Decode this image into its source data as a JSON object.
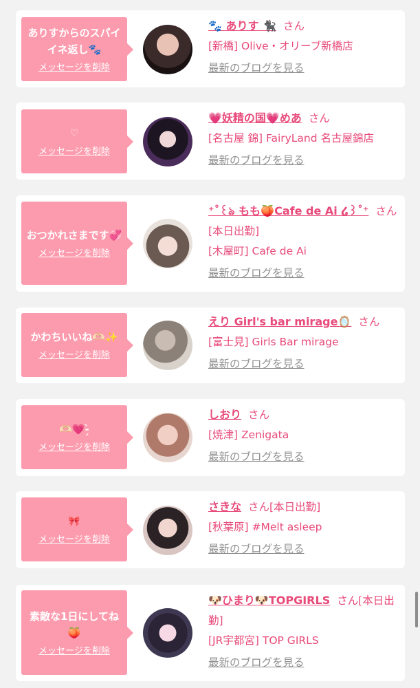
{
  "ui": {
    "delete_label": "メッセージを削除",
    "blog_label": "最新のブログを見る",
    "honorific": "さん"
  },
  "cards": [
    {
      "message": "ありすからのスパイイネ返し🐾",
      "name": "🐾 ありす 🐈‍⬛",
      "name_suffix": "",
      "shops": [
        "[新橋] Olive・オリーブ新橋店"
      ],
      "avatar_icon": "profile-photo"
    },
    {
      "message": "♡",
      "name": "💗妖精の国💗めあ",
      "name_suffix": "",
      "shops": [
        "[名古屋 錦] FairyLand 名古屋錦店"
      ],
      "avatar_icon": "profile-photo"
    },
    {
      "message": "おつかれさまです💞",
      "name": "⁺˚꒰ঌ もも🍑Cafe de Ai ໒꒱˚⁺",
      "name_suffix": "",
      "shops": [
        "[本日出勤]",
        "[木屋町] Cafe de Ai"
      ],
      "avatar_icon": "profile-photo"
    },
    {
      "message": "かわちいいね🫶🏻✨",
      "name": "えり Girl's bar mirage🪞",
      "name_suffix": "",
      "shops": [
        "[富士見] Girls Bar mirage"
      ],
      "avatar_icon": "profile-photo"
    },
    {
      "message": "🫶🏻💗-̗̀",
      "name": "しおり",
      "name_suffix": "",
      "shops": [
        "[焼津] Zenigata"
      ],
      "avatar_icon": "profile-photo"
    },
    {
      "message": "🎀",
      "name": "さきな",
      "name_suffix": "[本日出勤]",
      "shops": [
        "[秋葉原] #Melt asleep"
      ],
      "avatar_icon": "profile-photo"
    },
    {
      "message": "素敵な1日にしてね🍑",
      "name": "🐶ひまり🐶TOPGIRLS",
      "name_suffix": "[本日出勤]",
      "shops": [
        "[JR宇都宮] TOP GIRLS"
      ],
      "avatar_icon": "profile-photo"
    }
  ]
}
